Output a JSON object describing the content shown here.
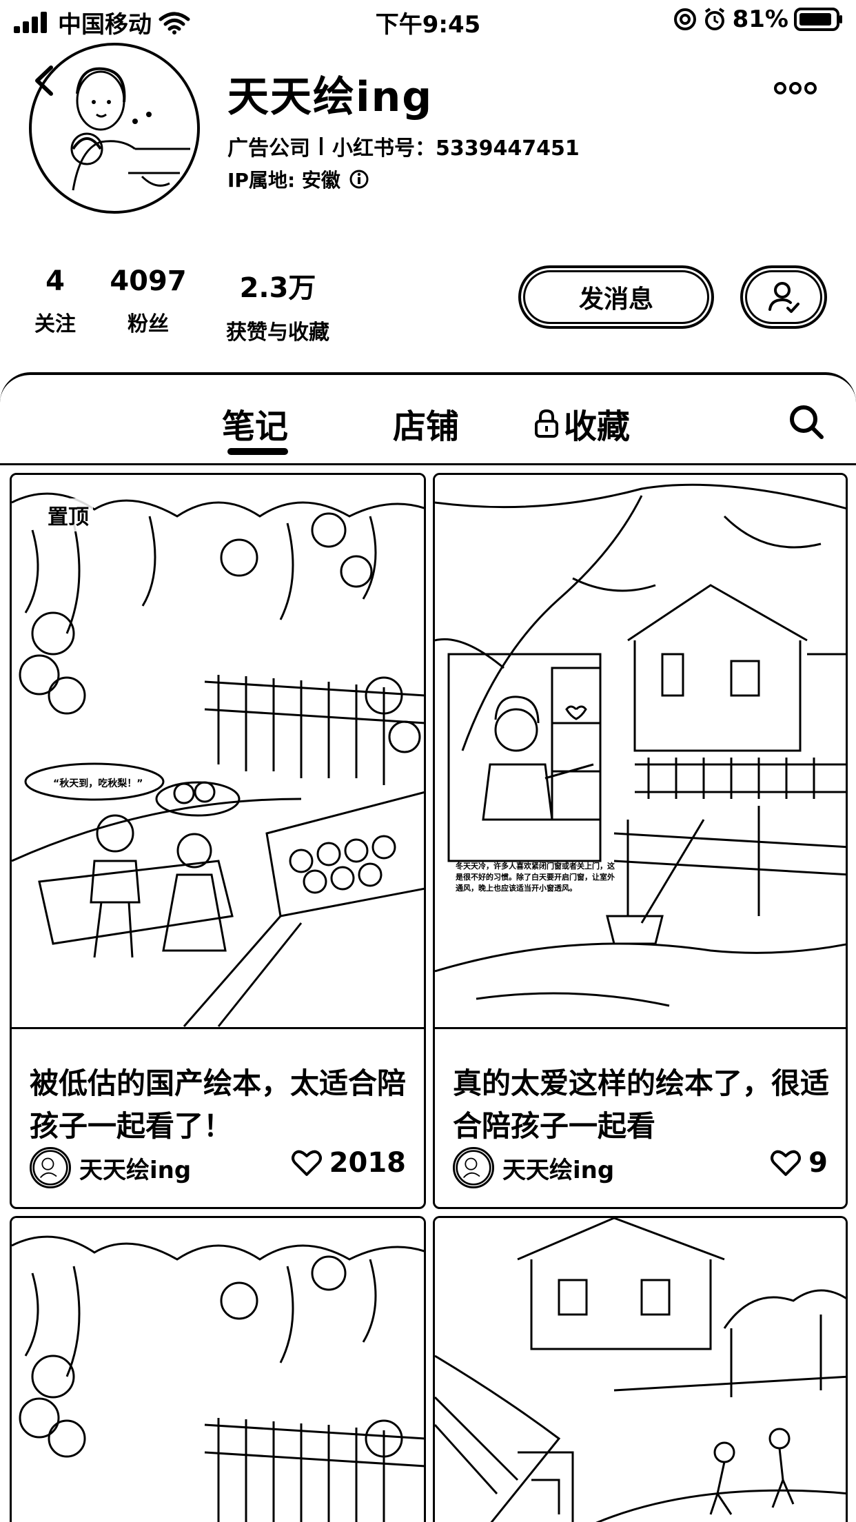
{
  "status_bar": {
    "carrier": "中国移动",
    "time": "下午9:45",
    "battery": "81%"
  },
  "profile": {
    "name": "天天绘ing",
    "tag": "广告公司",
    "id_label": "小红书号：",
    "id_value": "5339447451",
    "ip_label": "IP属地: 安徽"
  },
  "stats": [
    {
      "value": "4",
      "label": "关注"
    },
    {
      "value": "4097",
      "label": "粉丝"
    },
    {
      "value": "2.3万",
      "label": "获赞与收藏"
    }
  ],
  "actions": {
    "message_label": "发消息"
  },
  "tabs": [
    {
      "label": "笔记",
      "active": true
    },
    {
      "label": "店铺",
      "active": false
    },
    {
      "label": "收藏",
      "active": false,
      "locked": true
    }
  ],
  "notes": [
    {
      "pin_label": "置顶",
      "title": "被低估的国产绘本，太适合陪孩子一起看了！",
      "author": "天天绘ing",
      "likes": "2018",
      "speech": "“秋天到，吃秋梨！”"
    },
    {
      "title": "真的太爱这样的绘本了，很适合陪孩子一起看",
      "author": "天天绘ing",
      "likes": "9",
      "caption": "冬天天冷，许多人喜欢紧闭门窗或者关上门，这是很不好的习惯。除了白天要开启门窗，让室外通风，晚上也应该适当开小窗透风。"
    }
  ],
  "icons": {
    "signal": "signal-icon",
    "wifi": "wifi-icon",
    "battery": "battery-icon",
    "back": "back-icon",
    "more": "more-icon",
    "follow": "user-check-icon",
    "lock": "lock-icon",
    "search": "search-icon",
    "heart": "heart-icon"
  }
}
